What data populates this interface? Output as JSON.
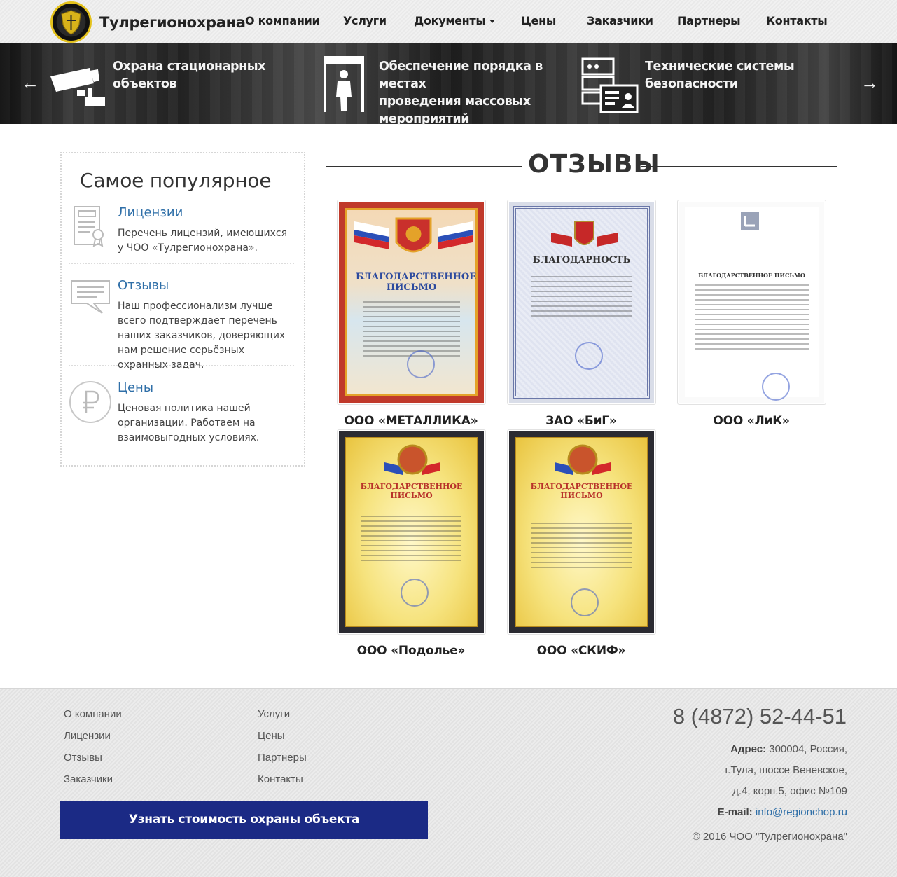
{
  "brand": {
    "name": "Тулрегионохрана",
    "logo_icon": "shield-emblem-icon"
  },
  "nav": {
    "items": [
      "О компании",
      "Услуги",
      "Документы",
      "Цены",
      "Заказчики",
      "Партнеры",
      "Контакты"
    ]
  },
  "slider": {
    "prev_label": "←",
    "next_label": "→",
    "slides": [
      {
        "title": "Охрана стационарных объектов",
        "icon": "security-camera-icon"
      },
      {
        "title_lines": [
          "Обеспечение порядка в местах",
          "проведения массовых",
          "мероприятий"
        ],
        "icon": "metal-detector-gate-icon"
      },
      {
        "title_lines": [
          "Технические системы",
          "безопасности"
        ],
        "icon": "server-id-card-icon"
      }
    ]
  },
  "sidebar": {
    "title": "Самое популярное",
    "items": [
      {
        "title": "Лицензии",
        "desc": "Перечень лицензий, имеющихся у ЧОО «Тулрегионохрана».",
        "icon": "certificate-icon"
      },
      {
        "title": "Отзывы",
        "desc": "Наш профессионализм лучше всего подтверждает перечень наших заказчиков, доверяющих нам решение серьёзных охранных задач.",
        "icon": "speech-bubble-icon"
      },
      {
        "title": "Цены",
        "desc": "Ценовая политика нашей организации. Работаем на взаимовыгодных условиях.",
        "icon": "ruble-icon"
      }
    ]
  },
  "reviews": {
    "title": "ОТЗЫВЫ",
    "items": [
      {
        "name": "ООО «МЕТАЛЛИКА»",
        "doc_heading": "БЛАГОДАРСТВЕННОЕ ПИСЬМО"
      },
      {
        "name": "ЗАО «БиГ»",
        "doc_heading": "БЛАГОДАРНОСТЬ"
      },
      {
        "name": "ООО «ЛиК»",
        "doc_heading": "БЛАГОДАРСТВЕННОЕ ПИСЬМО"
      },
      {
        "name": "ООО «Подолье»",
        "doc_heading": "БЛАГОДАРСТВЕННОЕ ПИСЬМО"
      },
      {
        "name": "ООО «СКИФ»",
        "doc_heading": "БЛАГОДАРСТВЕННОЕ ПИСЬМО"
      }
    ]
  },
  "footer": {
    "col1": [
      "О компании",
      "Лицензии",
      "Отзывы",
      "Заказчики"
    ],
    "col2": [
      "Услуги",
      "Цены",
      "Партнеры",
      "Контакты"
    ],
    "cta_label": "Узнать стоимость охраны объекта",
    "phone": "8 (4872) 52-44-51",
    "address_label": "Адрес:",
    "address_lines": [
      "300004, Россия,",
      "г.Тула, шоссе Веневское,",
      "д.4, корп.5, офис №109"
    ],
    "email_label": "E-mail:",
    "email": "info@regionchop.ru",
    "copyright": "© 2016 ЧОО \"Тулрегионохрана\""
  },
  "colors": {
    "accent_blue": "#2f6fa8",
    "cta_navy": "#1b2a85",
    "logo_gold": "#e4c21c"
  }
}
